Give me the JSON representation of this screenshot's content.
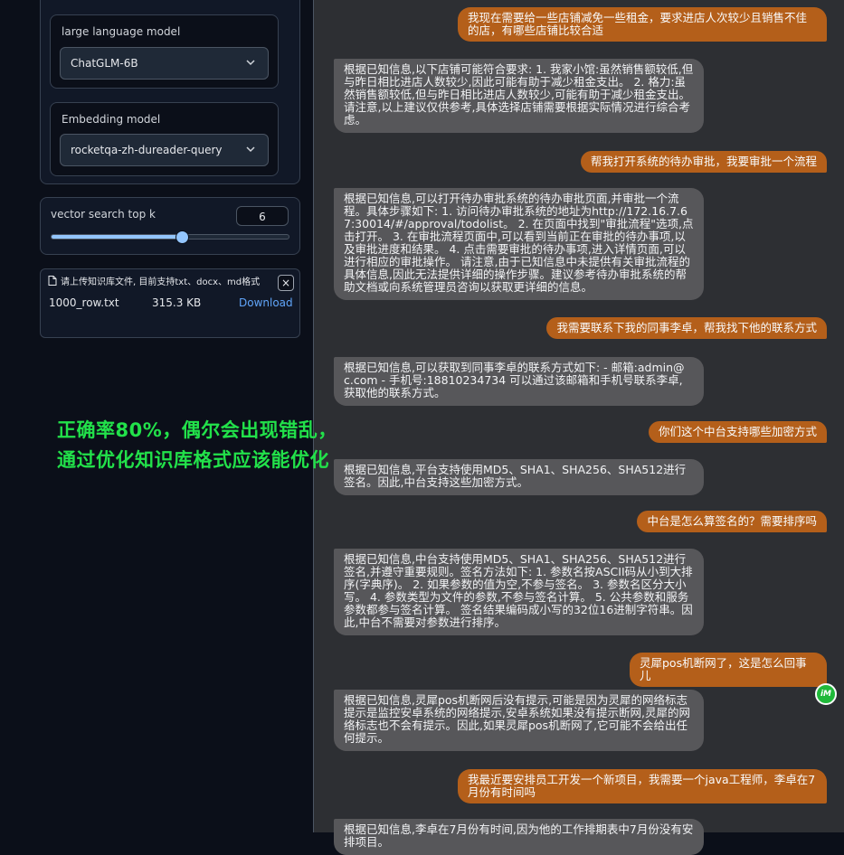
{
  "settings": {
    "llm": {
      "label": "large language model",
      "value": "ChatGLM-6B"
    },
    "embedding": {
      "label": "Embedding model",
      "value": "rocketqa-zh-dureader-query"
    },
    "top_k": {
      "label": "vector search top k",
      "value": "6",
      "fraction": 0.55
    },
    "upload": {
      "heading": "请上传知识库文件, 目前支持txt、docx、md格式",
      "file_name": "1000_row.txt",
      "file_size": "315.3 KB",
      "download_label": "Download",
      "close_label": "×"
    }
  },
  "overlay_text": {
    "line1": "正确率80%，偶尔会出现错乱，",
    "line2": "通过优化知识库格式应该能优化"
  },
  "badge_label": "iM",
  "messages": [
    {
      "role": "user",
      "text": "我现在需要给一些店铺减免一些租金，要求进店人次较少且销售不佳的店，有哪些店铺比较合适"
    },
    {
      "role": "bot",
      "text": "根据已知信息,以下店铺可能符合要求: 1. 我家小馆:虽然销售额较低,但与昨日相比进店人数较少,因此可能有助于减少租金支出。 2. 格力:虽然销售额较低,但与昨日相比进店人数较少,可能有助于减少租金支出。 请注意,以上建议仅供参考,具体选择店铺需要根据实际情况进行综合考虑。"
    },
    {
      "role": "user",
      "text": "帮我打开系统的待办审批，我要审批一个流程"
    },
    {
      "role": "bot",
      "text": "根据已知信息,可以打开待办审批系统的待办审批页面,并审批一个流程。具体步骤如下: 1. 访问待办审批系统的地址为http://172.16.7.67:30014/#/approval/todolist。 2. 在页面中找到\"审批流程\"选项,点击打开。 3. 在审批流程页面中,可以看到当前正在审批的待办事项,以及审批进度和结果。 4. 点击需要审批的待办事项,进入详情页面,可以进行相应的审批操作。 请注意,由于已知信息中未提供有关审批流程的具体信息,因此无法提供详细的操作步骤。建议参考待办审批系统的帮助文档或向系统管理员咨询以获取更详细的信息。"
    },
    {
      "role": "user",
      "text": "我需要联系下我的同事李卓，帮我找下他的联系方式"
    },
    {
      "role": "bot",
      "text": "根据已知信息,可以获取到同事李卓的联系方式如下: - 邮箱:admin@c.com - 手机号:18810234734 可以通过该邮箱和手机号联系李卓,获取他的联系方式。"
    },
    {
      "role": "user",
      "text": "你们这个中台支持哪些加密方式"
    },
    {
      "role": "bot",
      "text": "根据已知信息,平台支持使用MD5、SHA1、SHA256、SHA512进行签名。因此,中台支持这些加密方式。"
    },
    {
      "role": "user",
      "text": "中台是怎么算签名的？需要排序吗"
    },
    {
      "role": "bot",
      "text": "根据已知信息,中台支持使用MD5、SHA1、SHA256、SHA512进行签名,并遵守重要规则。签名方法如下: 1. 参数名按ASCII码从小到大排序(字典序)。 2. 如果参数的值为空,不参与签名。 3. 参数名区分大小写。 4. 参数类型为文件的参数,不参与签名计算。 5. 公共参数和服务参数都参与签名计算。 签名结果编码成小写的32位16进制字符串。因此,中台不需要对参数进行排序。"
    },
    {
      "role": "user",
      "text": "灵犀pos机断网了，这是怎么回事儿"
    },
    {
      "role": "bot",
      "text": "根据已知信息,灵犀pos机断网后没有提示,可能是因为灵犀的网络标志提示是监控安卓系统的网络提示,安卓系统如果没有提示断网,灵犀的网络标志也不会有提示。因此,如果灵犀pos机断网了,它可能不会给出任何提示。"
    },
    {
      "role": "user",
      "text": "我最近要安排员工开发一个新项目，我需要一个java工程师，李卓在7月份有时间吗"
    },
    {
      "role": "bot",
      "text": "根据已知信息,李卓在7月份有时间,因为他的工作排期表中7月份没有安排项目。"
    }
  ]
}
